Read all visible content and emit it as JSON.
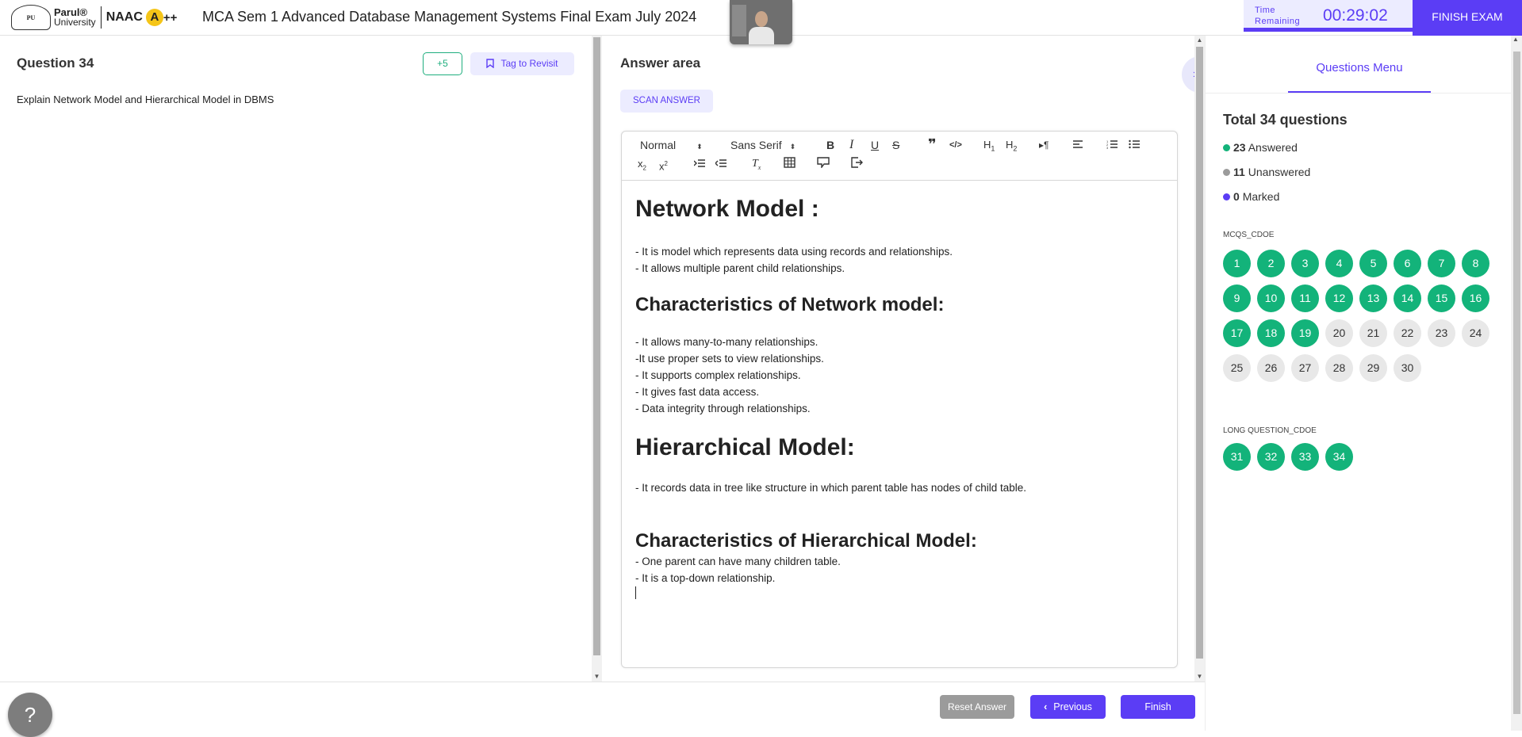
{
  "header": {
    "logo_university_line1": "Parul®",
    "logo_university_line2": "University",
    "logo_naac": "NAAC",
    "logo_grade": "A",
    "logo_grade_plus": "++",
    "exam_title": "MCA Sem 1 Advanced Database Management Systems Final Exam July 2024",
    "timer_label_line1": "Time",
    "timer_label_line2": "Remaining",
    "timer_value": "00:29:02",
    "finish_exam_label": "FINISH EXAM"
  },
  "question": {
    "title": "Question 34",
    "marks": "+5",
    "tag_label": "Tag to Revisit",
    "text": "Explain Network Model and Hierarchical Model in DBMS"
  },
  "answer": {
    "title": "Answer area",
    "scan_label": "SCAN ANSWER",
    "toolbar": {
      "format_select": "Normal",
      "font_select": "Sans Serif"
    },
    "content": {
      "h1_network": "Network Model :",
      "net_p1": "- It is model which represents data using records and relationships.",
      "net_p2": "- It allows multiple parent child relationships.",
      "h2_net_char": "Characteristics of Network model:",
      "net_c1": "- It allows many-to-many relationships.",
      "net_c2": "-It use proper sets to view relationships.",
      "net_c3": "- It supports complex relationships.",
      "net_c4": "- It gives fast data access.",
      "net_c5": "- Data integrity through relationships.",
      "h1_hier": "Hierarchical Model:",
      "hier_p1": "- It records data in tree like structure in  which parent table has nodes of child table.",
      "h2_hier_char": "Characteristics of Hierarchical Model:",
      "hier_c1": "- One parent can have many children table.",
      "hier_c2": "- It is a top-down relationship."
    }
  },
  "bottom": {
    "help_label": "?",
    "reset_label": "Reset Answer",
    "previous_label": "Previous",
    "finish_label": "Finish"
  },
  "menu": {
    "tab_label": "Questions Menu",
    "total_label": "Total 34 questions",
    "answered_count": "23",
    "answered_label": "Answered",
    "unanswered_count": "11",
    "unanswered_label": "Unanswered",
    "marked_count": "0",
    "marked_label": "Marked",
    "colors": {
      "answered": "#13b37a",
      "unanswered": "#9b9b9b",
      "marked": "#5b3df5"
    },
    "sections": [
      {
        "name": "MCQS_CDOE",
        "questions": [
          {
            "n": "1",
            "s": "answered"
          },
          {
            "n": "2",
            "s": "answered"
          },
          {
            "n": "3",
            "s": "answered"
          },
          {
            "n": "4",
            "s": "answered"
          },
          {
            "n": "5",
            "s": "answered"
          },
          {
            "n": "6",
            "s": "answered"
          },
          {
            "n": "7",
            "s": "answered"
          },
          {
            "n": "8",
            "s": "answered"
          },
          {
            "n": "9",
            "s": "answered"
          },
          {
            "n": "10",
            "s": "answered"
          },
          {
            "n": "11",
            "s": "answered"
          },
          {
            "n": "12",
            "s": "answered"
          },
          {
            "n": "13",
            "s": "answered"
          },
          {
            "n": "14",
            "s": "answered"
          },
          {
            "n": "15",
            "s": "answered"
          },
          {
            "n": "16",
            "s": "answered"
          },
          {
            "n": "17",
            "s": "answered"
          },
          {
            "n": "18",
            "s": "answered"
          },
          {
            "n": "19",
            "s": "answered"
          },
          {
            "n": "20",
            "s": "unanswered"
          },
          {
            "n": "21",
            "s": "unanswered"
          },
          {
            "n": "22",
            "s": "unanswered"
          },
          {
            "n": "23",
            "s": "unanswered"
          },
          {
            "n": "24",
            "s": "unanswered"
          },
          {
            "n": "25",
            "s": "unanswered"
          },
          {
            "n": "26",
            "s": "unanswered"
          },
          {
            "n": "27",
            "s": "unanswered"
          },
          {
            "n": "28",
            "s": "unanswered"
          },
          {
            "n": "29",
            "s": "unanswered"
          },
          {
            "n": "30",
            "s": "unanswered"
          }
        ]
      },
      {
        "name": "LONG QUESTION_CDOE",
        "questions": [
          {
            "n": "31",
            "s": "answered"
          },
          {
            "n": "32",
            "s": "answered"
          },
          {
            "n": "33",
            "s": "answered"
          },
          {
            "n": "34",
            "s": "answered"
          }
        ]
      }
    ]
  }
}
